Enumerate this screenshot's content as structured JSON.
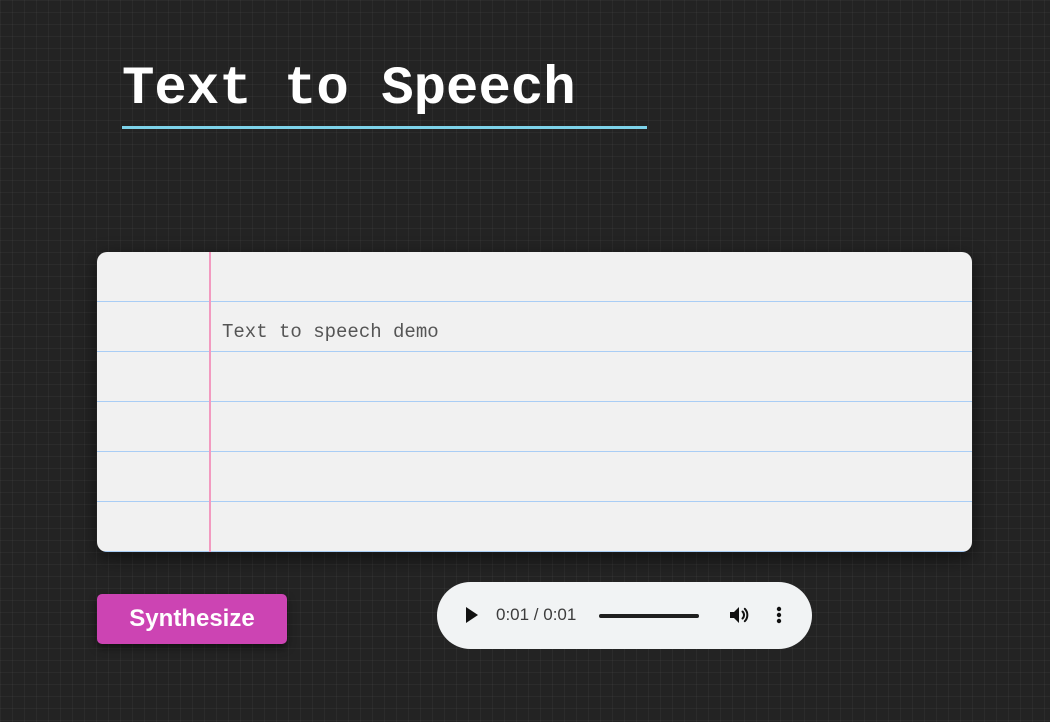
{
  "header": {
    "title": "Text to Speech",
    "underline_color": "#7dd3ea"
  },
  "text_area": {
    "value": "Text to speech demo",
    "margin_line_color": "#f29ac0",
    "rule_line_color": "#a9cdf5"
  },
  "synthesize_button": {
    "label": "Synthesize",
    "color": "#cc44b3"
  },
  "audio_player": {
    "time_display": "0:01 / 0:01",
    "progress_fraction": 1.0,
    "play_icon": "play-icon",
    "volume_icon": "volume-icon",
    "menu_icon": "more-vert-icon"
  }
}
